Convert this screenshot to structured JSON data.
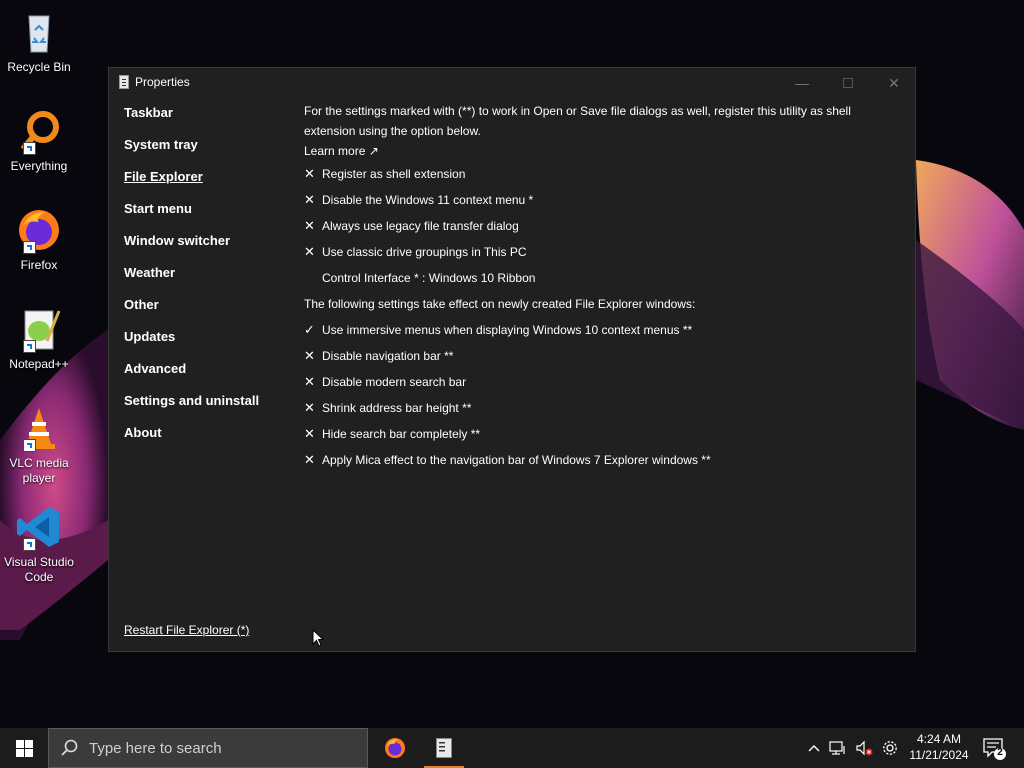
{
  "desktop": {
    "icons": [
      {
        "label": "Recycle Bin"
      },
      {
        "label": "Everything"
      },
      {
        "label": "Firefox"
      },
      {
        "label": "Notepad++"
      },
      {
        "label": "VLC media player"
      },
      {
        "label": "Visual Studio Code"
      }
    ]
  },
  "window": {
    "title": "Properties",
    "nav": [
      "Taskbar",
      "System tray",
      "File Explorer",
      "Start menu",
      "Window switcher",
      "Weather",
      "Other",
      "Updates",
      "Advanced",
      "Settings and uninstall",
      "About"
    ],
    "active_nav": "File Explorer",
    "intro": "For the settings marked with (**) to work in Open or Save file dialogs as well, register this utility as shell extension using the option below.",
    "learn_more": "Learn more ↗",
    "options_top": [
      {
        "mark": "✕",
        "label": "Register as shell extension"
      },
      {
        "mark": "✕",
        "label": "Disable the Windows 11 context menu *"
      },
      {
        "mark": "✕",
        "label": "Always use legacy file transfer dialog"
      },
      {
        "mark": "✕",
        "label": "Use classic drive groupings in This PC"
      }
    ],
    "control_interface": "Control Interface * : Windows 10 Ribbon",
    "section_heading": "The following settings take effect on newly created File Explorer windows:",
    "options_bottom": [
      {
        "mark": "✓",
        "label": "Use immersive menus when displaying Windows 10 context menus **"
      },
      {
        "mark": "✕",
        "label": "Disable navigation bar **"
      },
      {
        "mark": "✕",
        "label": "Disable modern search bar"
      },
      {
        "mark": "✕",
        "label": "Shrink address bar height **"
      },
      {
        "mark": "✕",
        "label": "Hide search bar completely **"
      },
      {
        "mark": "✕",
        "label": "Apply Mica effect to the navigation bar of Windows 7 Explorer windows **"
      }
    ],
    "restart": "Restart File Explorer (*)"
  },
  "taskbar": {
    "search_placeholder": "Type here to search",
    "time": "4:24 AM",
    "date": "11/21/2024",
    "notification_count": "2",
    "accent": "#e4822e"
  }
}
